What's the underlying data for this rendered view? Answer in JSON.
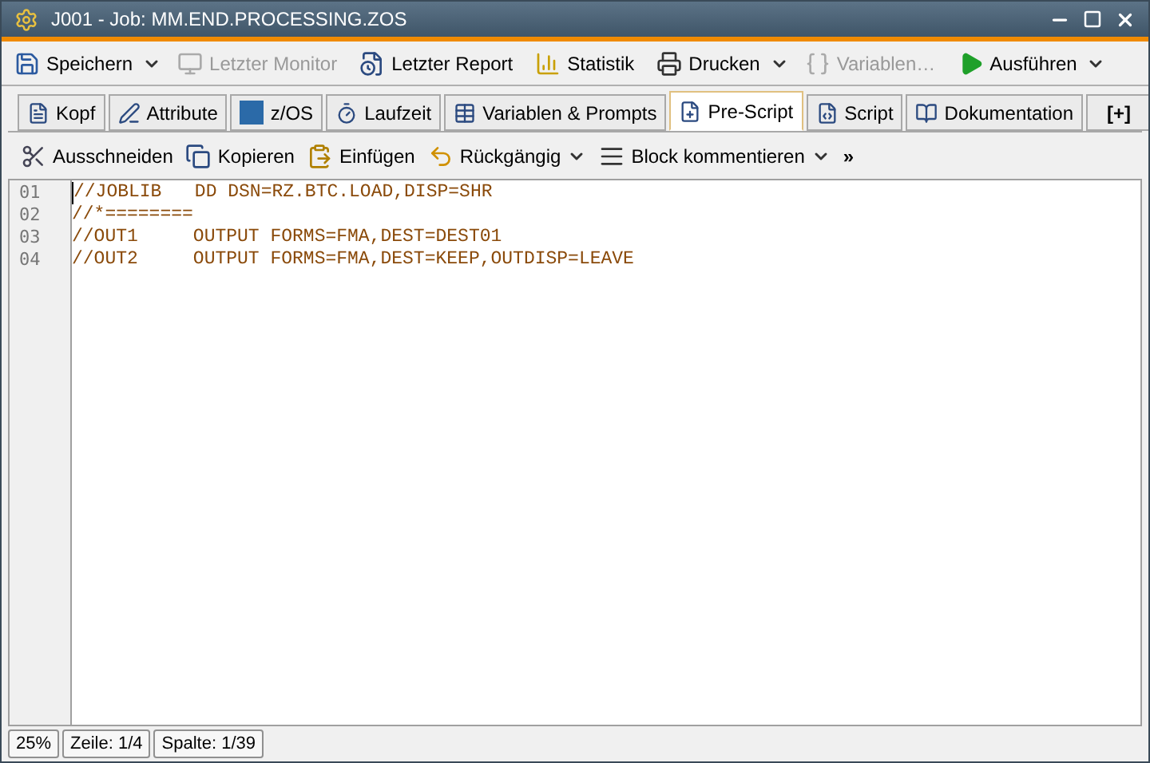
{
  "window": {
    "title": "J001 - Job: MM.END.PROCESSING.ZOS"
  },
  "toolbar": [
    {
      "label": "Speichern",
      "disabled": false,
      "dropdown": true
    },
    {
      "label": "Letzter Monitor",
      "disabled": true,
      "dropdown": false
    },
    {
      "label": "Letzter Report",
      "disabled": false,
      "dropdown": false
    },
    {
      "label": "Statistik",
      "disabled": false,
      "dropdown": false
    },
    {
      "label": "Drucken",
      "disabled": false,
      "dropdown": true
    },
    {
      "label": "Variablen…",
      "disabled": true,
      "dropdown": false
    },
    {
      "label": "Ausführen",
      "disabled": false,
      "dropdown": true
    }
  ],
  "tabs": [
    {
      "label": "Kopf",
      "selected": false
    },
    {
      "label": "Attribute",
      "selected": false
    },
    {
      "label": "z/OS",
      "selected": false
    },
    {
      "label": "Laufzeit",
      "selected": false
    },
    {
      "label": "Variablen & Prompts",
      "selected": false
    },
    {
      "label": "Pre-Script",
      "selected": true
    },
    {
      "label": "Script",
      "selected": false
    },
    {
      "label": "Dokumentation",
      "selected": false
    },
    {
      "label": "[+]",
      "selected": false
    }
  ],
  "edit_toolbar": [
    {
      "label": "Ausschneiden",
      "dropdown": false
    },
    {
      "label": "Kopieren",
      "dropdown": false
    },
    {
      "label": "Einfügen",
      "dropdown": false
    },
    {
      "label": "Rückgängig",
      "dropdown": true
    },
    {
      "label": "Block kommentieren",
      "dropdown": true
    },
    {
      "label": "»",
      "dropdown": false
    }
  ],
  "editor": {
    "lines": [
      {
        "number": "01",
        "text": "//JOBLIB   DD DSN=RZ.BTC.LOAD,DISP=SHR"
      },
      {
        "number": "02",
        "text": "//*========"
      },
      {
        "number": "03",
        "text": "//OUT1     OUTPUT FORMS=FMA,DEST=DEST01"
      },
      {
        "number": "04",
        "text": "//OUT2     OUTPUT FORMS=FMA,DEST=KEEP,OUTDISP=LEAVE"
      }
    ]
  },
  "status_bar": [
    "25%",
    "Zeile: 1/4",
    "Spalte: 1/39"
  ]
}
